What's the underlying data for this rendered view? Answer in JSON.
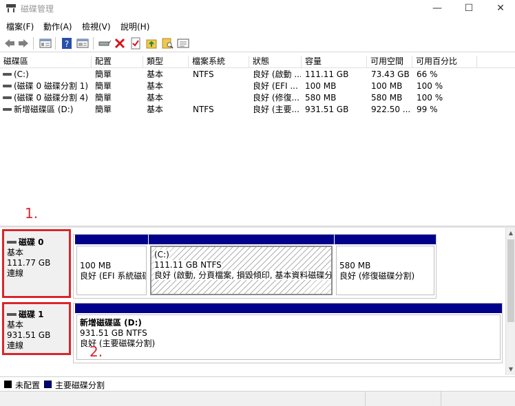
{
  "window": {
    "title": "磁碟管理",
    "minimize": "—",
    "maximize": "☐",
    "close": "✕"
  },
  "menu": [
    "檔案(F)",
    "動作(A)",
    "檢視(V)",
    "說明(H)"
  ],
  "toolbar": {
    "icons": [
      "back-arrow-icon",
      "forward-arrow-icon",
      "show-hide-console-tree-icon",
      "help-icon",
      "properties-icon",
      "connect-drive-icon",
      "delete-icon",
      "check-icon",
      "up-folder-icon",
      "search-folder-icon",
      "console-icon"
    ]
  },
  "volume_list": {
    "headers": [
      "磁碟區",
      "配置",
      "類型",
      "檔案系統",
      "狀態",
      "容量",
      "可用空間",
      "可用百分比"
    ],
    "rows": [
      [
        "(C:)",
        "簡單",
        "基本",
        "NTFS",
        "良好 (啟動 ...",
        "111.11 GB",
        "73.43 GB",
        "66 %"
      ],
      [
        "(磁碟 0 磁碟分割 1)",
        "簡單",
        "基本",
        "",
        "良好 (EFI ...",
        "100 MB",
        "100 MB",
        "100 %"
      ],
      [
        "(磁碟 0 磁碟分割 4)",
        "簡單",
        "基本",
        "",
        "良好 (修復...",
        "580 MB",
        "580 MB",
        "100 %"
      ],
      [
        "新增磁碟區 (D:)",
        "簡單",
        "基本",
        "NTFS",
        "良好 (主要...",
        "931.51 GB",
        "922.50 ...",
        "99 %"
      ]
    ]
  },
  "annotations": {
    "first": "1.",
    "second": "2."
  },
  "disks": [
    {
      "name": "磁碟 0",
      "type": "基本",
      "size": "111.77 GB",
      "status": "連線",
      "partitions": [
        {
          "line1": "100 MB",
          "line2": "良好 (EFI 系統磁碟分割)"
        },
        {
          "line0": "(C:)",
          "line1": "111.11 GB NTFS",
          "line2": "良好 (啟動, 分頁檔案, 損毀傾印, 基本資料磁碟分割)"
        },
        {
          "line1": "580 MB",
          "line2": "良好 (修復磁碟分割)"
        }
      ]
    },
    {
      "name": "磁碟 1",
      "type": "基本",
      "size": "931.51 GB",
      "status": "連線",
      "partitions": [
        {
          "line0": "新增磁碟區 (D:)",
          "line1": "931.51 GB NTFS",
          "line2": "良好 (主要磁碟分割)"
        }
      ]
    }
  ],
  "legend": {
    "items": [
      {
        "label": "未配置",
        "color": "#000000"
      },
      {
        "label": "主要磁碟分割",
        "color": "#00008b"
      }
    ]
  }
}
